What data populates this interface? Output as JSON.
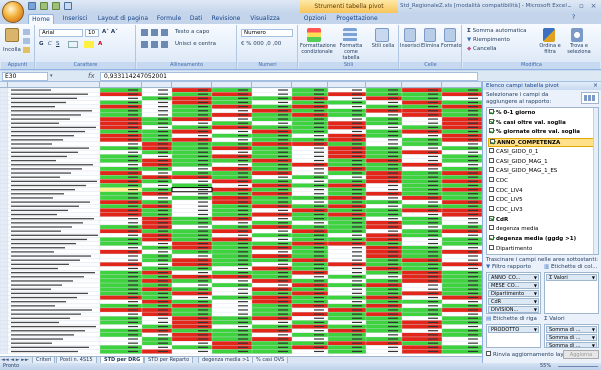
{
  "window": {
    "title": "Std_RegionaleZ.xls [modalità compatibilità] - Microsoft Excel",
    "context_tab": "Strumenti tabella pivot"
  },
  "ribbon_tabs": [
    "Home",
    "Inserisci",
    "Layout di pagina",
    "Formule",
    "Dati",
    "Revisione",
    "Visualizza",
    "Opzioni",
    "Progettazione"
  ],
  "ribbon": {
    "paste": "Incolla",
    "font_name": "Arial",
    "font_size": "10",
    "wrap_text": "Testo a capo",
    "merge_center": "Unisci e centra",
    "number_format": "Numero",
    "conditional_format": "Formattazione condizionale",
    "format_table": "Formatta come tabella",
    "cell_styles": "Stili cella",
    "insert": "Inserisci",
    "delete": "Elimina",
    "format": "Formato",
    "autosum": "Somma automatica",
    "fill": "Riempimento",
    "clear": "Cancella",
    "sort_filter": "Ordina e filtra",
    "find_select": "Trova e seleziona",
    "groups": [
      "Appunti",
      "Carattere",
      "Allineamento",
      "Numeri",
      "Stili",
      "Celle",
      "Modifica"
    ]
  },
  "formula_bar": {
    "name_box": "E30",
    "fx": "fx",
    "value": "0,933114247052001"
  },
  "sheet_tabs": [
    "Criteri",
    "Posti n. 4S15",
    "STD per DRG",
    "STD per Reparto",
    "degenza media >1",
    "% casi OVS"
  ],
  "active_sheet": "STD per DRG",
  "status": {
    "left": "Pronto",
    "zoom": "55%"
  },
  "pivot_panel": {
    "title": "Elenco campi tabella pivot",
    "select_label": "Selezionare i campi da aggiungere al rapporto:",
    "fields": [
      {
        "label": "% 0-1 giorno",
        "checked": true,
        "bold": true
      },
      {
        "label": "% casi oltre val. soglia",
        "checked": true,
        "bold": true
      },
      {
        "label": "% giornate oltre val. soglia",
        "checked": true,
        "bold": true
      },
      {
        "label": "ANNO_COMPETENZA",
        "checked": true,
        "bold": true,
        "selected": true
      },
      {
        "label": "CASI_GIDO_0_1",
        "checked": false,
        "bold": false
      },
      {
        "label": "CASI_GIDO_MAG_1",
        "checked": false,
        "bold": false
      },
      {
        "label": "CASI_GIDO_MAG_1_ES",
        "checked": false,
        "bold": false
      },
      {
        "label": "CDC",
        "checked": false,
        "bold": false
      },
      {
        "label": "CDC_LIV4",
        "checked": false,
        "bold": false
      },
      {
        "label": "CDC_LIV5",
        "checked": false,
        "bold": false
      },
      {
        "label": "CDC_LIV3",
        "checked": false,
        "bold": false
      },
      {
        "label": "CdR",
        "checked": true,
        "bold": true
      },
      {
        "label": "degenza media",
        "checked": false,
        "bold": false
      },
      {
        "label": "degenza media (ggdg >1)",
        "checked": true,
        "bold": true
      },
      {
        "label": "Dipartimento",
        "checked": false,
        "bold": false
      }
    ],
    "drag_label": "Trascinare i campi nelle aree sottostanti:",
    "report_filter_label": "Filtro rapporto",
    "column_labels_label": "Etichette di col...",
    "report_filters": [
      "ANNO_CO...",
      "MESE_CO...",
      "Dipartimento",
      "CdR",
      "DIVISION..."
    ],
    "column_items": [
      "Σ Valori"
    ],
    "row_labels_label": "Etichette di riga",
    "values_label": "Σ Valori",
    "row_items": [
      "PRODOTTO"
    ],
    "value_items": [
      "Somma di ...",
      "Somma di ...",
      "Somma di ...",
      "Somma di ..."
    ],
    "defer_label": "Rinvia aggiornamento layout",
    "update_button": "Aggiorna"
  },
  "icons": {
    "office": "office-button-icon",
    "save": "save-icon",
    "undo": "undo-icon",
    "redo": "redo-icon",
    "settings": "field-list-layout-icon"
  }
}
